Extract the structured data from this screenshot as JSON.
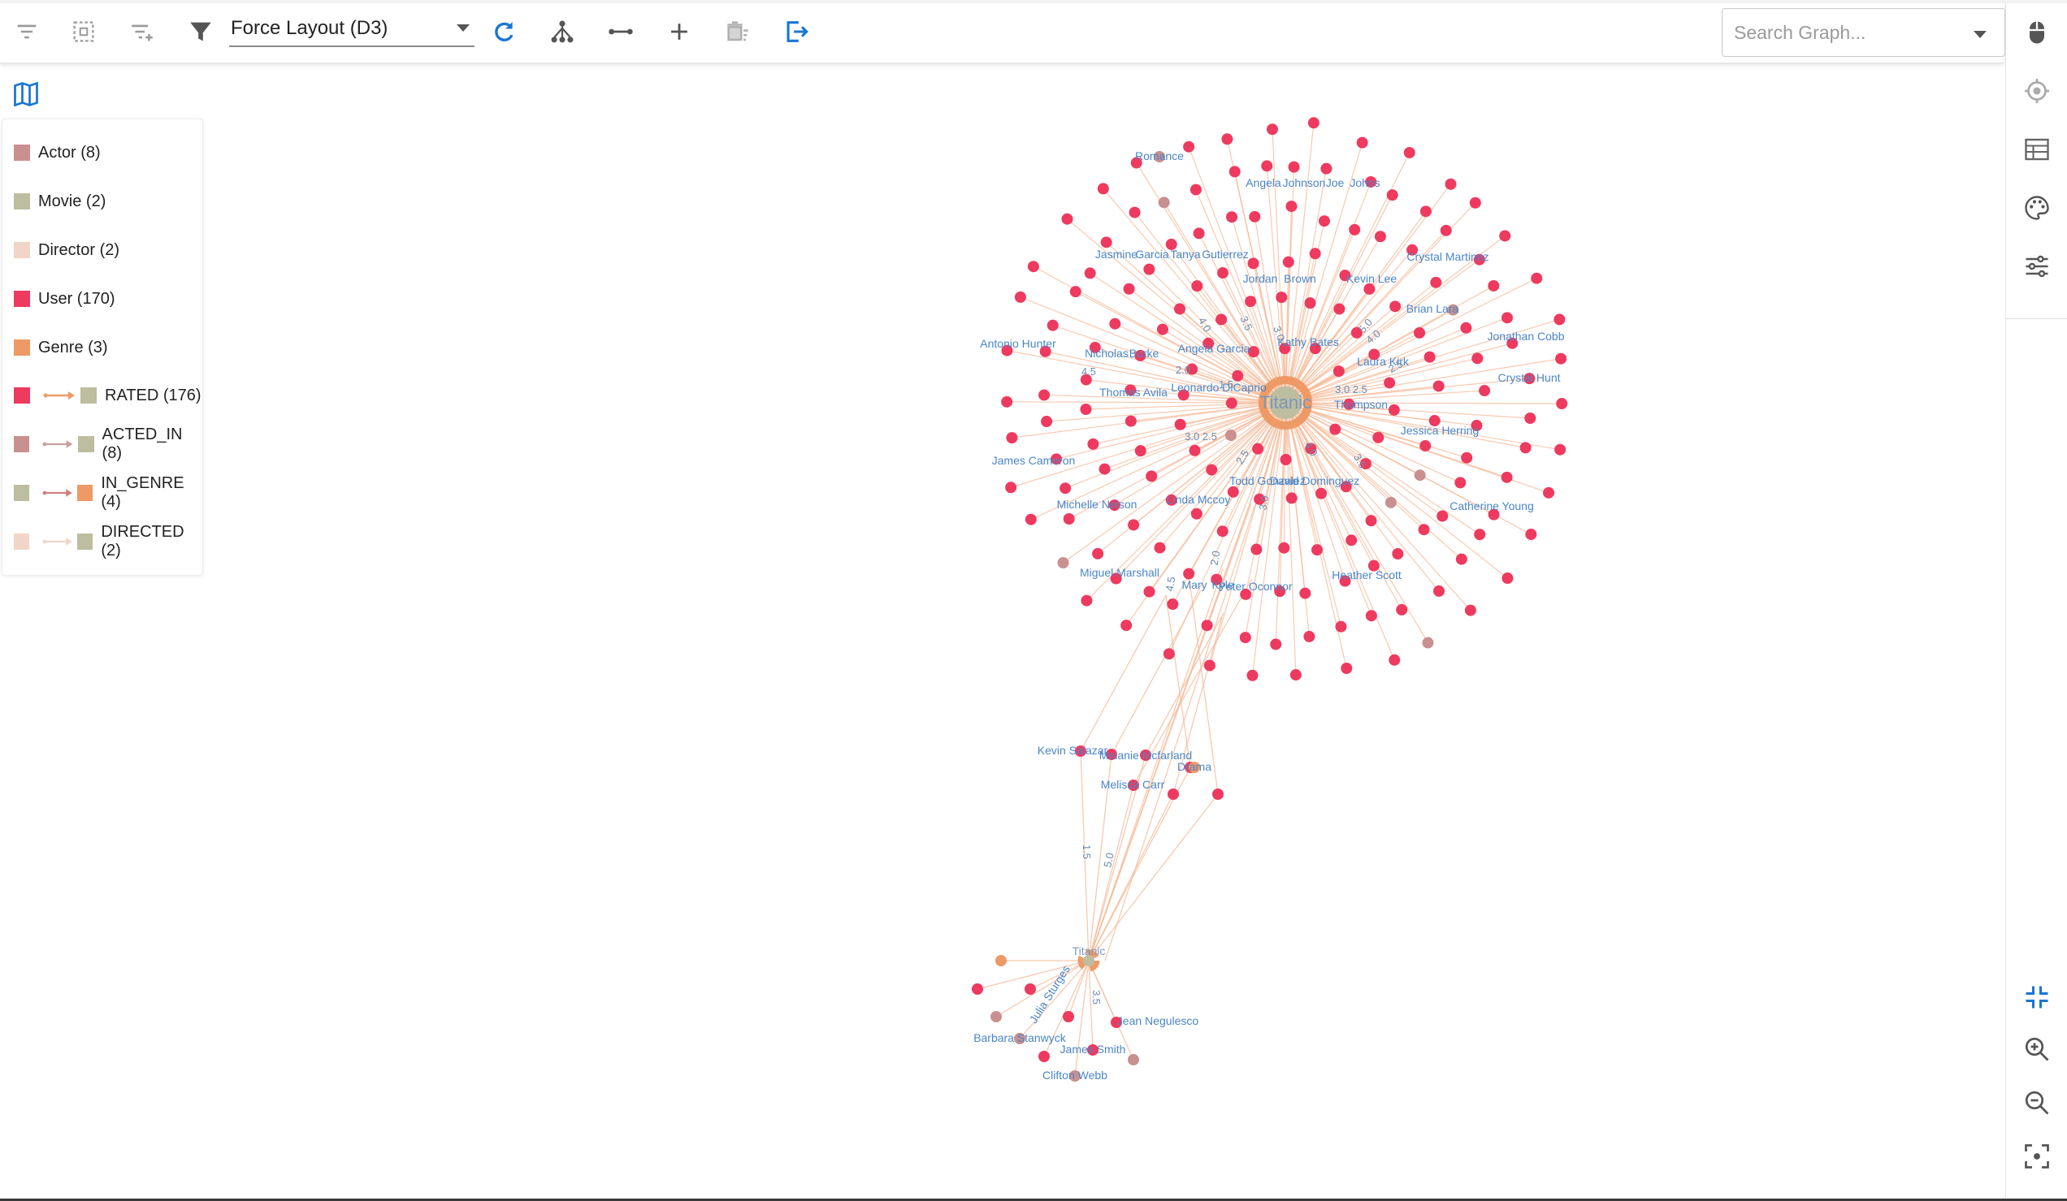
{
  "toolbar": {
    "layout_value": "Force Layout (D3)",
    "search_placeholder": "Search Graph..."
  },
  "legend": {
    "nodes": [
      {
        "label": "Actor (8)",
        "color": "#c99090"
      },
      {
        "label": "Movie (2)",
        "color": "#bdbda0"
      },
      {
        "label": "Director (2)",
        "color": "#f1d5c6"
      },
      {
        "label": "User (170)",
        "color": "#ee3a5f"
      },
      {
        "label": "Genre (3)",
        "color": "#ee9a66"
      }
    ],
    "relationships": [
      {
        "label": "RATED (176)",
        "from": "#ee3a5f",
        "line": "#ee9a66",
        "to": "#bdbda0"
      },
      {
        "label": "ACTED_IN (8)",
        "from": "#c99090",
        "line": "#c99090",
        "to": "#bdbda0"
      },
      {
        "label": "IN_GENRE (4)",
        "from": "#bdbda0",
        "line": "#d08080",
        "to": "#ee9a66"
      },
      {
        "label": "DIRECTED (2)",
        "from": "#f1d5c6",
        "line": "#f1d5c6",
        "to": "#bdbda0"
      }
    ]
  },
  "colors": {
    "accent": "#1976d2",
    "user": "#ee3a5f",
    "actor": "#c99090",
    "movie": "#bdbda0",
    "genre": "#ee9a66",
    "edge": "#f5b896",
    "label": "#4a86c8"
  },
  "graph": {
    "movies": [
      {
        "label": "Titanic",
        "size": "large"
      },
      {
        "label": "Titanic",
        "size": "small"
      }
    ],
    "top_labels": [
      "Romance",
      "Angela",
      "Johnson",
      "Joe",
      "Johns",
      "Jasmine",
      "Garcia",
      "Tanya",
      "Gutierrez",
      "Crystal Martinez",
      "Jordan",
      "Brown",
      "Kevin Lee",
      "Brian Lara",
      "Jonathan Cobb",
      "Antonio Hunter",
      "Nicholas",
      "Burke",
      "Angela Garcia",
      "Kathy Bates",
      "Laura Kirk",
      "Crystal Hunt",
      "Thomas Avila",
      "Leonardo DiCaprio",
      "Thompson",
      "Jessica Herring",
      "James Cameron",
      "Todd Gonzalez",
      "David Dominguez",
      "Michelle Nelson",
      "Linda Mccoy",
      "Catherine Young",
      "Miguel Marshall",
      "Mary",
      "Kyle",
      "Peter Oconnor",
      "Heather Scott"
    ],
    "middle_labels": [
      "Kevin Salazar",
      "Melanie Mcfarland",
      "Drama",
      "Melissa Carr"
    ],
    "bottom_labels": [
      "Julia Sturges",
      "Jean Negulesco",
      "Barbara Stanwyck",
      "James Smith",
      "Clifton Webb"
    ],
    "edge_labels": [
      "4.0",
      "3.5",
      "3.0",
      "2.0",
      "4.5",
      "1.5",
      "5.0",
      "3.0 2.5",
      "2.5"
    ]
  }
}
